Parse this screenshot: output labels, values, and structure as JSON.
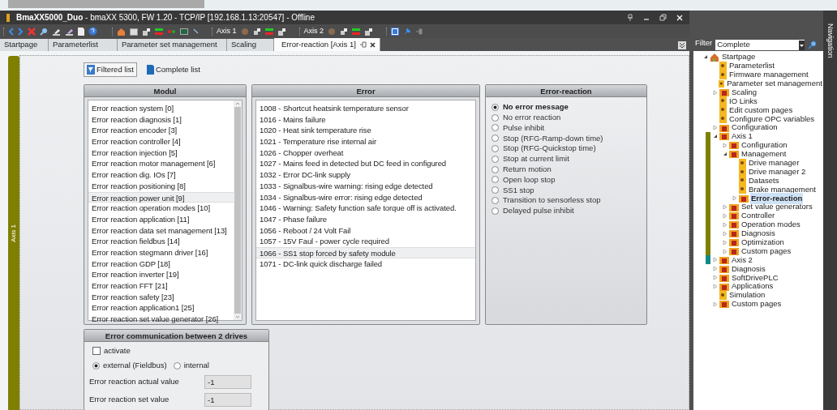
{
  "window": {
    "title": "**BmaXX5000_Duo** - bmaXX 5300, FW 1.20 - TCP/IP [192.168.1.13:20547] - Offline"
  },
  "toolbar": {
    "groups": [
      {
        "label": "Axis 1"
      },
      {
        "label": "Axis 2"
      }
    ]
  },
  "tabs": [
    {
      "label": "Startpage",
      "selected": false
    },
    {
      "label": "Parameterlist",
      "selected": false
    },
    {
      "label": "Parameter set management",
      "selected": false
    },
    {
      "label": "Scaling",
      "selected": false
    },
    {
      "label": "Error-reaction [Axis 1]",
      "selected": true
    }
  ],
  "side_tab": {
    "label": "Axis 1"
  },
  "view_buttons": [
    {
      "label": "Filtered list",
      "selected": true
    },
    {
      "label": "Complete list",
      "selected": false
    }
  ],
  "modul": {
    "title": "Modul",
    "items": [
      {
        "label": "Error reaction system [0]",
        "selected": false
      },
      {
        "label": "Error reaction diagnosis [1]",
        "selected": false
      },
      {
        "label": "Error reaction encoder [3]",
        "selected": false
      },
      {
        "label": "Error reaction controller [4]",
        "selected": false
      },
      {
        "label": "Error reaction injection [5]",
        "selected": false
      },
      {
        "label": "Error reaction motor management [6]",
        "selected": false
      },
      {
        "label": "Error reaction dig. IOs [7]",
        "selected": false
      },
      {
        "label": "Error reaction positioning [8]",
        "selected": false
      },
      {
        "label": "Error reaction power unit [9]",
        "selected": true
      },
      {
        "label": "Error reaction operation modes [10]",
        "selected": false
      },
      {
        "label": "Error reaction application [11]",
        "selected": false
      },
      {
        "label": "Error reaction data set management [13]",
        "selected": false
      },
      {
        "label": "Error reaction fieldbus [14]",
        "selected": false
      },
      {
        "label": "Error reaction stegmann driver [16]",
        "selected": false
      },
      {
        "label": "Error reaction GDP [18]",
        "selected": false
      },
      {
        "label": "Error reaction inverter [19]",
        "selected": false
      },
      {
        "label": "Error reaction FFT [21]",
        "selected": false
      },
      {
        "label": "Error reaction safety [23]",
        "selected": false
      },
      {
        "label": "Error reaction application1 [25]",
        "selected": false
      },
      {
        "label": "Error reaction set value generator [26]",
        "selected": false
      }
    ]
  },
  "error": {
    "title": "Error",
    "items": [
      {
        "label": "1008 - Shortcut heatsink temperature sensor",
        "selected": false
      },
      {
        "label": "1016 - Mains failure",
        "selected": false
      },
      {
        "label": "1020 - Heat sink temperature rise",
        "selected": false
      },
      {
        "label": "1021 - Temperature rise internal air",
        "selected": false
      },
      {
        "label": "1026 - Chopper overheat",
        "selected": false
      },
      {
        "label": "1027 - Mains feed in detected but DC feed in configured",
        "selected": false
      },
      {
        "label": "1032 - Error DC-link supply",
        "selected": false
      },
      {
        "label": "1033 - Signalbus-wire warning: rising edge detected",
        "selected": false
      },
      {
        "label": "1034 - Signalbus-wire error: rising edge detected",
        "selected": false
      },
      {
        "label": "1046 - Warning: Safety function safe torque off is activated.",
        "selected": false
      },
      {
        "label": "1047 - Phase failure",
        "selected": false
      },
      {
        "label": "1056 - Reboot / 24 Volt Fail",
        "selected": false
      },
      {
        "label": "1057 - 15V Faul - power cycle required",
        "selected": false
      },
      {
        "label": "1066 - SS1 stop forced by safety module",
        "selected": true
      },
      {
        "label": "1071 - DC-link quick discharge failed",
        "selected": false
      }
    ]
  },
  "error_reaction": {
    "title": "Error-reaction",
    "options": [
      {
        "label": "No error message",
        "selected": true
      },
      {
        "label": "No error reaction",
        "selected": false
      },
      {
        "label": "Pulse inhibit",
        "selected": false
      },
      {
        "label": "Stop (RFG-Ramp-down time)",
        "selected": false
      },
      {
        "label": "Stop (RFG-Quickstop time)",
        "selected": false
      },
      {
        "label": "Stop at current limit",
        "selected": false
      },
      {
        "label": "Return motion",
        "selected": false
      },
      {
        "label": "Open loop stop",
        "selected": false
      },
      {
        "label": "SS1 stop",
        "selected": false
      },
      {
        "label": "Transition to sensorless stop",
        "selected": false
      },
      {
        "label": "Delayed pulse inhibit",
        "selected": false
      }
    ]
  },
  "communication": {
    "title": "Error communication between 2 drives",
    "activate": {
      "label": "activate",
      "checked": false
    },
    "mode_options": [
      {
        "label": "external (Fieldbus)",
        "selected": true
      },
      {
        "label": "internal",
        "selected": false
      }
    ],
    "fields": [
      {
        "label": "Error reaction actual value",
        "value": "-1"
      },
      {
        "label": "Error reaction set value",
        "value": "-1"
      }
    ]
  },
  "navigation": {
    "panel_label": "Navigation",
    "filter": {
      "label": "Filter",
      "value": "Complete"
    },
    "tree": [
      {
        "label": "Startpage",
        "kind": "home",
        "expanded": true,
        "selected": false,
        "children": [
          {
            "label": "Parameterlist",
            "kind": "page",
            "selected": false
          },
          {
            "label": "Firmware management",
            "kind": "page",
            "selected": false
          },
          {
            "label": "Parameter set management",
            "kind": "page",
            "selected": false
          },
          {
            "label": "Scaling",
            "kind": "folder",
            "expanded": false,
            "selected": false
          },
          {
            "label": "IO Links",
            "kind": "page",
            "selected": false
          },
          {
            "label": "Edit custom pages",
            "kind": "page",
            "selected": false
          },
          {
            "label": "Configure OPC variables",
            "kind": "page",
            "selected": false
          },
          {
            "label": "Configuration",
            "kind": "folder",
            "expanded": false,
            "selected": false
          },
          {
            "label": "Axis 1",
            "kind": "folder",
            "expanded": true,
            "selected": false,
            "color": "#7f8000",
            "children": [
              {
                "label": "Configuration",
                "kind": "folder",
                "expanded": false,
                "selected": false
              },
              {
                "label": "Management",
                "kind": "folder",
                "expanded": true,
                "selected": false,
                "children": [
                  {
                    "label": "Drive manager",
                    "kind": "page",
                    "selected": false
                  },
                  {
                    "label": "Drive manager 2",
                    "kind": "page",
                    "selected": false
                  },
                  {
                    "label": "Datasets",
                    "kind": "page",
                    "selected": false
                  },
                  {
                    "label": "Brake management",
                    "kind": "page",
                    "selected": false
                  },
                  {
                    "label": "Error-reaction",
                    "kind": "folder",
                    "expanded": false,
                    "selected": true
                  }
                ]
              },
              {
                "label": "Set value generators",
                "kind": "folder",
                "expanded": false,
                "selected": false
              },
              {
                "label": "Controller",
                "kind": "folder",
                "expanded": false,
                "selected": false
              },
              {
                "label": "Operation modes",
                "kind": "folder",
                "expanded": false,
                "selected": false
              },
              {
                "label": "Diagnosis",
                "kind": "folder",
                "expanded": false,
                "selected": false
              },
              {
                "label": "Optimization",
                "kind": "folder",
                "expanded": false,
                "selected": false
              },
              {
                "label": "Custom pages",
                "kind": "folder",
                "expanded": false,
                "selected": false
              }
            ]
          },
          {
            "label": "Axis 2",
            "kind": "folder",
            "expanded": false,
            "selected": false,
            "color": "#138a8a"
          },
          {
            "label": "Diagnosis",
            "kind": "folder",
            "expanded": false,
            "selected": false
          },
          {
            "label": "SoftDrivePLC",
            "kind": "folder",
            "expanded": false,
            "selected": false
          },
          {
            "label": "Applications",
            "kind": "folder",
            "expanded": false,
            "selected": false
          },
          {
            "label": "Simulation",
            "kind": "page",
            "selected": false
          },
          {
            "label": "Custom pages",
            "kind": "folder",
            "expanded": false,
            "selected": false
          }
        ]
      }
    ]
  }
}
